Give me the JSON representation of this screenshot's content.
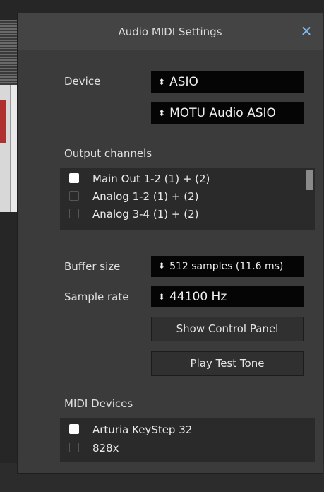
{
  "dialog": {
    "title": "Audio MIDI Settings",
    "close_glyph": "✕"
  },
  "device": {
    "label": "Device",
    "type_value": "ASIO",
    "driver_value": "MOTU Audio ASIO",
    "arrow_glyph": "⬍"
  },
  "output": {
    "label": "Output channels",
    "channels": [
      {
        "name": "Main Out 1-2 (1) + (2)",
        "checked": true
      },
      {
        "name": "Analog 1-2 (1) + (2)",
        "checked": false
      },
      {
        "name": "Analog 3-4 (1) + (2)",
        "checked": false
      }
    ]
  },
  "buffer": {
    "label": "Buffer size",
    "value": "512 samples (11.6 ms)"
  },
  "sample_rate": {
    "label": "Sample rate",
    "value": "44100 Hz"
  },
  "buttons": {
    "control_panel": "Show Control Panel",
    "test_tone": "Play Test Tone"
  },
  "midi": {
    "label": "MIDI Devices",
    "devices": [
      {
        "name": "Arturia KeyStep 32",
        "checked": true
      },
      {
        "name": "828x",
        "checked": false
      }
    ]
  }
}
